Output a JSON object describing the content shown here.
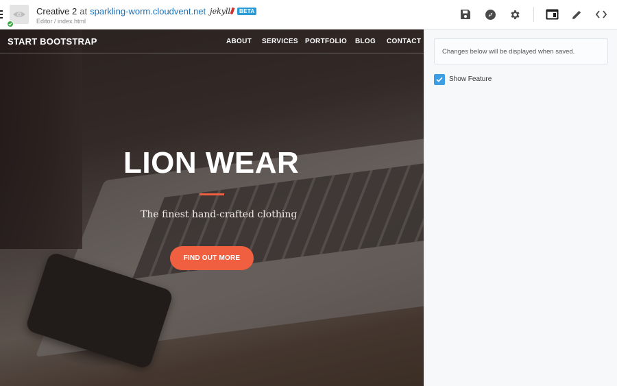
{
  "header": {
    "site_name": "Creative 2",
    "at_word": "at",
    "host": "sparkling-worm.cloudvent.net",
    "generator_logo_text": "jekyll",
    "beta_label": "BETA",
    "breadcrumb": "Editor / index.html",
    "toolbar_icons": [
      "save-icon",
      "compass-icon",
      "gear-icon",
      "layout-icon",
      "pencil-icon",
      "code-icon"
    ]
  },
  "preview": {
    "brand": "START BOOTSTRAP",
    "nav": [
      "ABOUT",
      "SERVICES",
      "PORTFOLIO",
      "BLOG",
      "CONTACT"
    ],
    "hero_title": "LION WEAR",
    "hero_subtitle": "The finest hand-crafted clothing",
    "cta_label": "FIND OUT MORE",
    "accent_color": "#f05f40"
  },
  "panel": {
    "notice": "Changes below will be displayed when saved.",
    "checkbox_label": "Show Feature",
    "checkbox_checked": true,
    "checkbox_color": "#3d9ee3"
  }
}
